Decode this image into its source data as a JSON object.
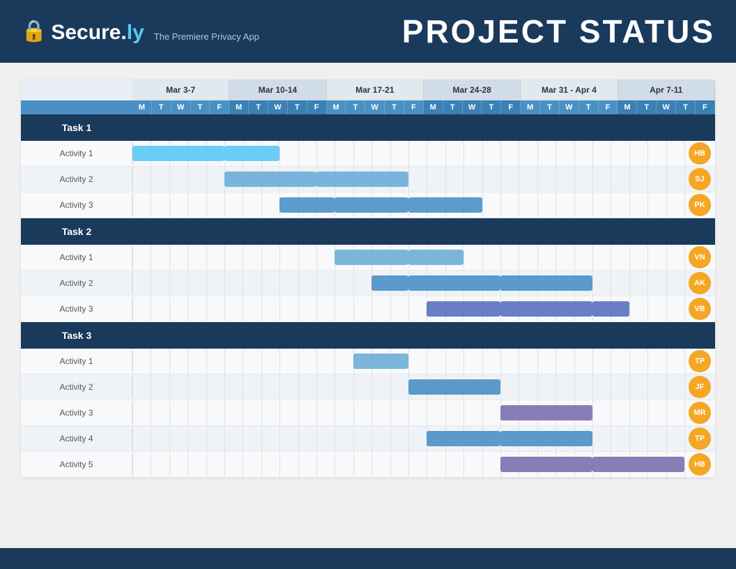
{
  "header": {
    "logo_lock": "🔒",
    "logo_text_main": "Secure.",
    "logo_text_accent": "ly",
    "tagline": "The Premiere Privacy App",
    "title": "PROJECT STATUS"
  },
  "weeks": [
    {
      "label": "Mar 3-7",
      "days": [
        "M",
        "T",
        "W",
        "T",
        "F"
      ]
    },
    {
      "label": "Mar 10-14",
      "days": [
        "M",
        "T",
        "W",
        "T",
        "F"
      ]
    },
    {
      "label": "Mar 17-21",
      "days": [
        "M",
        "T",
        "W",
        "T",
        "F"
      ]
    },
    {
      "label": "Mar 24-28",
      "days": [
        "M",
        "T",
        "W",
        "T",
        "F"
      ]
    },
    {
      "label": "Mar 31 - Apr 4",
      "days": [
        "M",
        "T",
        "W",
        "T",
        "F"
      ]
    },
    {
      "label": "Apr 7-11",
      "days": [
        "M",
        "T",
        "W",
        "T",
        "F"
      ]
    }
  ],
  "tasks": [
    {
      "id": "task1",
      "label": "Task 1",
      "activities": [
        {
          "label": "Activity 1",
          "avatar": "HB",
          "color": "#5bc8f5",
          "bars": [
            {
              "start": 0,
              "width": 5
            },
            {
              "start": 5,
              "width": 3
            }
          ]
        },
        {
          "label": "Activity 2",
          "avatar": "SJ",
          "color": "#6baed6",
          "bars": [
            {
              "start": 5,
              "width": 5
            },
            {
              "start": 10,
              "width": 5
            }
          ]
        },
        {
          "label": "Activity 3",
          "avatar": "PK",
          "color": "#4a90c4",
          "bars": [
            {
              "start": 8,
              "width": 3
            },
            {
              "start": 11,
              "width": 4
            },
            {
              "start": 15,
              "width": 4
            }
          ]
        }
      ]
    },
    {
      "id": "task2",
      "label": "Task 2",
      "activities": [
        {
          "label": "Activity 1",
          "avatar": "VN",
          "color": "#6baed6",
          "bars": [
            {
              "start": 11,
              "width": 4
            },
            {
              "start": 15,
              "width": 3
            }
          ]
        },
        {
          "label": "Activity 2",
          "avatar": "AK",
          "color": "#4a90c4",
          "bars": [
            {
              "start": 13,
              "width": 2
            },
            {
              "start": 15,
              "width": 5
            },
            {
              "start": 20,
              "width": 5
            }
          ]
        },
        {
          "label": "Activity 3",
          "avatar": "VB",
          "color": "#5b6fbf",
          "bars": [
            {
              "start": 16,
              "width": 4
            },
            {
              "start": 20,
              "width": 5
            },
            {
              "start": 25,
              "width": 2
            }
          ]
        }
      ]
    },
    {
      "id": "task3",
      "label": "Task 3",
      "activities": [
        {
          "label": "Activity 1",
          "avatar": "TP",
          "color": "#6baed6",
          "bars": [
            {
              "start": 12,
              "width": 3
            }
          ]
        },
        {
          "label": "Activity 2",
          "avatar": "JF",
          "color": "#4a90c4",
          "bars": [
            {
              "start": 15,
              "width": 5
            }
          ]
        },
        {
          "label": "Activity 3",
          "avatar": "MR",
          "color": "#7b6faf",
          "bars": [
            {
              "start": 20,
              "width": 5
            }
          ]
        },
        {
          "label": "Activity 4",
          "avatar": "TP",
          "color": "#4a90c4",
          "bars": [
            {
              "start": 16,
              "width": 4
            },
            {
              "start": 20,
              "width": 5
            }
          ]
        },
        {
          "label": "Activity 5",
          "avatar": "HB",
          "color": "#7b6faf",
          "bars": [
            {
              "start": 20,
              "width": 5
            },
            {
              "start": 25,
              "width": 5
            }
          ]
        }
      ]
    }
  ],
  "avatar_colors": {
    "HB": "#f5a623",
    "SJ": "#f5a623",
    "PK": "#f5a623",
    "VN": "#f5a623",
    "AK": "#f5a623",
    "VB": "#f5a623",
    "TP": "#f5a623",
    "JF": "#f5a623",
    "MR": "#f5a623"
  }
}
